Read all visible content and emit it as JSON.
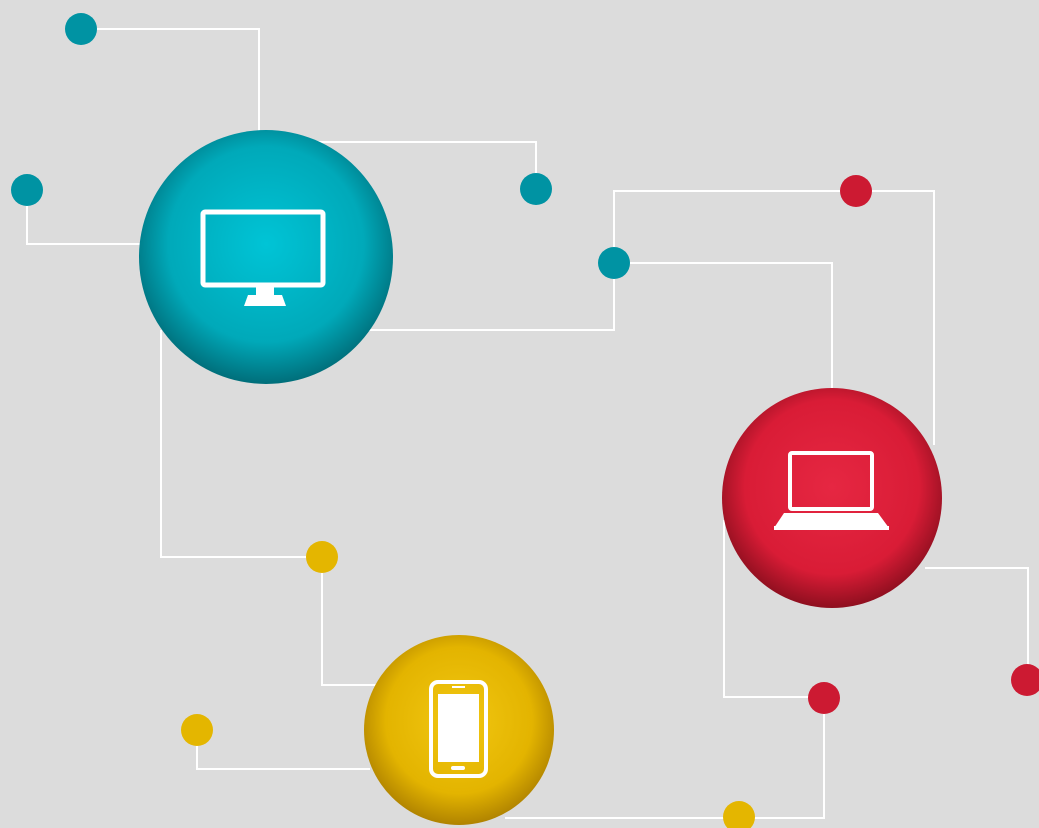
{
  "background": "#dcdcdc",
  "line_color": "#ffffff",
  "colors": {
    "teal": "#00a0b0",
    "teal_dot": "#0093a3",
    "red": "#d81a35",
    "red_dot": "#cc1a32",
    "yellow": "#e5b800",
    "yellow_dot": "#e4b600"
  },
  "hubs": [
    {
      "id": "desktop",
      "icon": "desktop-monitor-icon",
      "color": "teal"
    },
    {
      "id": "laptop",
      "icon": "laptop-icon",
      "color": "red"
    },
    {
      "id": "mobile",
      "icon": "smartphone-icon",
      "color": "yellow"
    }
  ],
  "nodes": [
    {
      "id": "teal-node-1",
      "color": "teal"
    },
    {
      "id": "teal-node-2",
      "color": "teal"
    },
    {
      "id": "teal-node-3",
      "color": "teal"
    },
    {
      "id": "teal-node-4",
      "color": "teal"
    },
    {
      "id": "red-node-1",
      "color": "red"
    },
    {
      "id": "red-node-2",
      "color": "red"
    },
    {
      "id": "red-node-3",
      "color": "red"
    },
    {
      "id": "yellow-node-1",
      "color": "yellow"
    },
    {
      "id": "yellow-node-2",
      "color": "yellow"
    },
    {
      "id": "yellow-node-3",
      "color": "yellow"
    }
  ]
}
